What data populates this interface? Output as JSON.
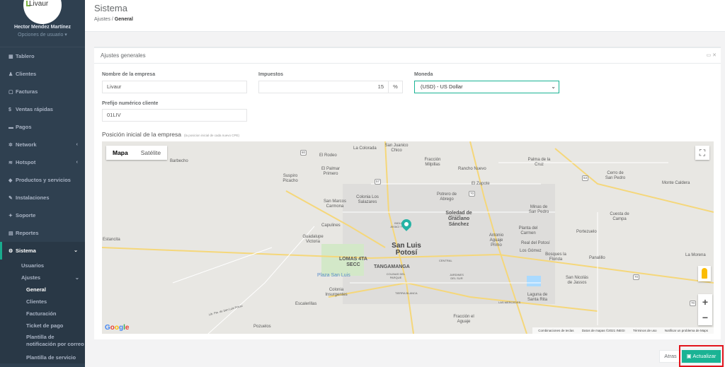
{
  "sidebar": {
    "logo_text": "Livaur",
    "user_name": "Hector Mendez Martínez",
    "user_options": "Opciones de usuario ▾",
    "items": [
      {
        "icon": "dashboard-icon",
        "glyph": "▦",
        "label": "Tablero"
      },
      {
        "icon": "users-icon",
        "glyph": "👥",
        "label": "Clientes"
      },
      {
        "icon": "file-icon",
        "glyph": "▢",
        "label": "Facturas"
      },
      {
        "icon": "dollar-icon",
        "glyph": "$",
        "label": "Ventas rápidas"
      },
      {
        "icon": "card-icon",
        "glyph": "▬",
        "label": "Pagos"
      },
      {
        "icon": "network-icon",
        "glyph": "✲",
        "label": "Network"
      },
      {
        "icon": "wifi-icon",
        "glyph": "≋",
        "label": "Hotspot"
      },
      {
        "icon": "cube-icon",
        "glyph": "◆",
        "label": "Productos y servicios"
      },
      {
        "icon": "wrench-icon",
        "glyph": "✎",
        "label": "Instalaciones"
      },
      {
        "icon": "ticket-icon",
        "glyph": "✦",
        "label": "Soporte"
      },
      {
        "icon": "book-icon",
        "glyph": "▤",
        "label": "Reportes"
      },
      {
        "icon": "cogs-icon",
        "glyph": "⚙",
        "label": "Sistema"
      }
    ],
    "sub": {
      "usuarios": "Usuarios",
      "ajustes": "Ajustes",
      "general": "General",
      "clientes": "Clientes",
      "facturacion": "Facturación",
      "ticket": "Ticket de pago",
      "plantilla_notif": "Plantilla de notificación por correo",
      "plantilla_serv": "Plantilla de servicio"
    }
  },
  "header": {
    "title": "Sistema",
    "crumb_parent": "Ajustes",
    "crumb_sep": "/",
    "crumb_current": "General"
  },
  "panel": {
    "title": "Ajustes generales",
    "tools": "▭ ✕",
    "company_label": "Nombre de la empresa",
    "company_value": "Livaur",
    "tax_label": "Impuestos",
    "tax_value": "15",
    "tax_addon": "%",
    "currency_label": "Moneda",
    "currency_value": "(USD) - US Dollar",
    "prefix_label": "Prefijo numérico cliente",
    "prefix_value": "01LIV",
    "position_title": "Posición inicial de la empresa",
    "position_hint": "(la posicion inicial de cada nuevo CPE)"
  },
  "map": {
    "tab_map": "Mapa",
    "tab_sat": "Satélite",
    "google": "Google",
    "attrib": [
      "Combinaciones de teclas",
      "Datos de mapas ©2021 INEGI",
      "Términos de uso",
      "Notificar un problema de Maps"
    ],
    "places": {
      "barrenada": "El Rodeo",
      "colorada": "La Colorada",
      "sanjuanico": "San Juanico Chico",
      "fraccion_milpillas": "Fracción Milpillas",
      "barbecho": "Barbecho",
      "palmar": "El Palmar Primero",
      "rancho_nuevo": "Rancho Nuevo",
      "palma_cruz": "Palma de la Cruz",
      "suspiro": "Suspiro Picacho",
      "zapote": "El Zapote",
      "cerro_sp": "Cerro de San Pedro",
      "monte_caldera": "Monte Caldera",
      "salazares": "Colonia Los Salazares",
      "potrero": "Potrero de Abrego",
      "san_marcos": "San Marcos Carmona",
      "soledad": "Soledad de Graciano Sánchez",
      "minas": "Minas de San Pedro",
      "cuesta": "Cuesta de Campa",
      "capulines": "Capulines",
      "estancita": "Estancita",
      "guadalupe": "Guadalupe Victoria",
      "slp": "San Luis Potosí",
      "antonio_aguaje": "Antonio Aguaje Primo",
      "planta": "Planta del Carmen",
      "portezuelo": "Portezuelo",
      "real_potosi": "Real del Potosí",
      "lomas": "LOMAS 4TA SECC",
      "tangamanga": "TANGAMANGA",
      "los_gomez": "Los Gómez",
      "bosques": "Bosques la Florida",
      "panalillo": "Panalillo",
      "la_morena": "La Morena",
      "plaza_sl": "Plaza San Luis",
      "san_nicolas": "San Nicolás de Jassos",
      "col_insurgentes": "Colonia Insurgentes",
      "laguna": "Laguna de Santa Rita",
      "escalerillas": "Escalerillas",
      "fraccion_aguaje": "Fracción el Aguaje",
      "pozuelos": "Pozuelos",
      "industr": "INDUSTR AVIACI Y SA SE",
      "colinas": "COLINAS DEL PARQUE",
      "jardines": "JARDINES DEL SUR",
      "tierra": "TIERRA BLANCA",
      "mercedes": "LAS MERCEDES",
      "central": "CENTRAL",
      "sector": "SECTOR",
      "via": "Lib. Pte. de San Luis Potosí"
    }
  },
  "footer": {
    "back_label": "Atras",
    "update_label": "▣ Actualizar"
  },
  "colors": {
    "sidebar_bg": "#2f4050",
    "accent": "#1ab394",
    "highlight": "#e2141c"
  }
}
